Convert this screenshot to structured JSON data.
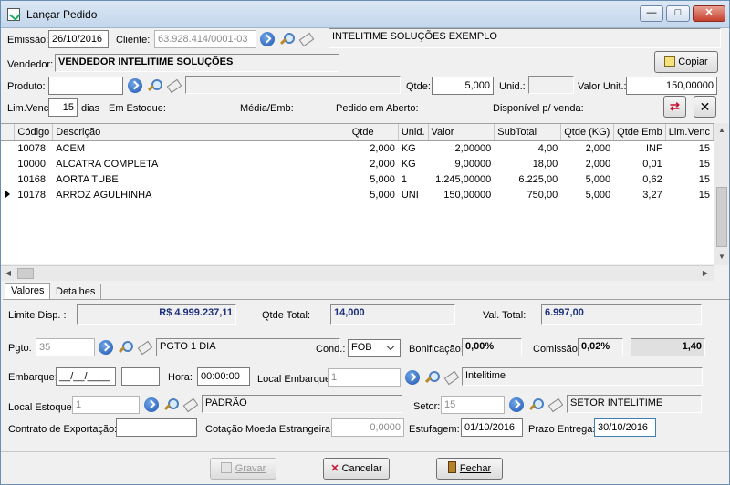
{
  "window": {
    "title": "Lançar Pedido"
  },
  "header": {
    "emissao_label": "Emissão:",
    "emissao_value": "26/10/2016",
    "cliente_label": "Cliente:",
    "cliente_code": "63.928.414/0001-03",
    "cliente_name": "INTELITIME SOLUÇÕES EXEMPLO",
    "vendedor_label": "Vendedor:",
    "vendedor_name": "VENDEDOR INTELITIME SOLUÇÕES",
    "copiar_label": "Copiar"
  },
  "produto": {
    "produto_label": "Produto:",
    "produto_value": "",
    "qtde_label": "Qtde:",
    "qtde_value": "5,000",
    "unid_label": "Unid.:",
    "unid_value": "",
    "valor_unit_label": "Valor Unit.:",
    "valor_unit_value": "150,00000",
    "lim_venc_label": "Lim.Venc:",
    "lim_venc_value": "15",
    "dias_label": "dias",
    "em_estoque_label": "Em Estoque:",
    "media_emb_label": "Média/Emb:",
    "pedido_aberto_label": "Pedido em Aberto:",
    "disponivel_label": "Disponível p/ venda:"
  },
  "grid": {
    "columns": [
      "Código",
      "Descrição",
      "Qtde",
      "Unid.",
      "Valor",
      "SubTotal",
      "Qtde (KG)",
      "Qtde Emb",
      "Lim.Venc"
    ],
    "rows": [
      {
        "codigo": "10078",
        "descricao": "ACEM",
        "qtde": "2,000",
        "unid": "KG",
        "valor": "2,00000",
        "subtotal": "4,00",
        "qtde_kg": "2,000",
        "qtde_emb": "INF",
        "lim": "15"
      },
      {
        "codigo": "10000",
        "descricao": "ALCATRA COMPLETA",
        "qtde": "2,000",
        "unid": "KG",
        "valor": "9,00000",
        "subtotal": "18,00",
        "qtde_kg": "2,000",
        "qtde_emb": "0,01",
        "lim": "15"
      },
      {
        "codigo": "10168",
        "descricao": "AORTA TUBE",
        "qtde": "5,000",
        "unid": "1",
        "valor": "1.245,00000",
        "subtotal": "6.225,00",
        "qtde_kg": "5,000",
        "qtde_emb": "0,62",
        "lim": "15"
      },
      {
        "codigo": "10178",
        "descricao": "ARROZ AGULHINHA",
        "qtde": "5,000",
        "unid": "UNI",
        "valor": "150,00000",
        "subtotal": "750,00",
        "qtde_kg": "5,000",
        "qtde_emb": "3,27",
        "lim": "15"
      }
    ]
  },
  "tabs": [
    "Valores",
    "Detalhes"
  ],
  "valores": {
    "limite_disp_label": "Limite Disp. :",
    "limite_disp_value": "R$ 4.999.237,11",
    "qtde_total_label": "Qtde Total:",
    "qtde_total_value": "14,000",
    "val_total_label": "Val. Total:",
    "val_total_value": "6.997,00",
    "pgto_label": "Pgto:",
    "pgto_code": "35",
    "pgto_desc": "PGTO 1 DIA",
    "cond_label": "Cond.:",
    "cond_value": "FOB",
    "bonificacao_label": "Bonificação:",
    "bonificacao_value": "0,00%",
    "comissao_label": "Comissão:",
    "comissao_value": "0,02%",
    "comissao_total": "1,40",
    "embarque_label": "Embarque:",
    "embarque_value": "__/__/____",
    "hora_label": "Hora:",
    "hora_value": "00:00:00",
    "local_embarque_label": "Local Embarque:",
    "local_embarque_code": "1",
    "local_embarque_desc": "Intelitime",
    "local_estoque_label": "Local Estoque:",
    "local_estoque_code": "1",
    "local_estoque_desc": "PADRÃO",
    "setor_label": "Setor:",
    "setor_code": "15",
    "setor_desc": "SETOR INTELITIME",
    "contrato_label": "Contrato de Exportação:",
    "contrato_value": "",
    "cotacao_label": "Cotação Moeda Estrangeira:",
    "cotacao_value": "0,0000",
    "estufagem_label": "Estufagem:",
    "estufagem_value": "01/10/2016",
    "prazo_entrega_label": "Prazo Entrega:",
    "prazo_entrega_value": "30/10/2016"
  },
  "footer": {
    "gravar_label": "Gravar",
    "cancelar_label": "Cancelar",
    "fechar_label": "Fechar"
  }
}
